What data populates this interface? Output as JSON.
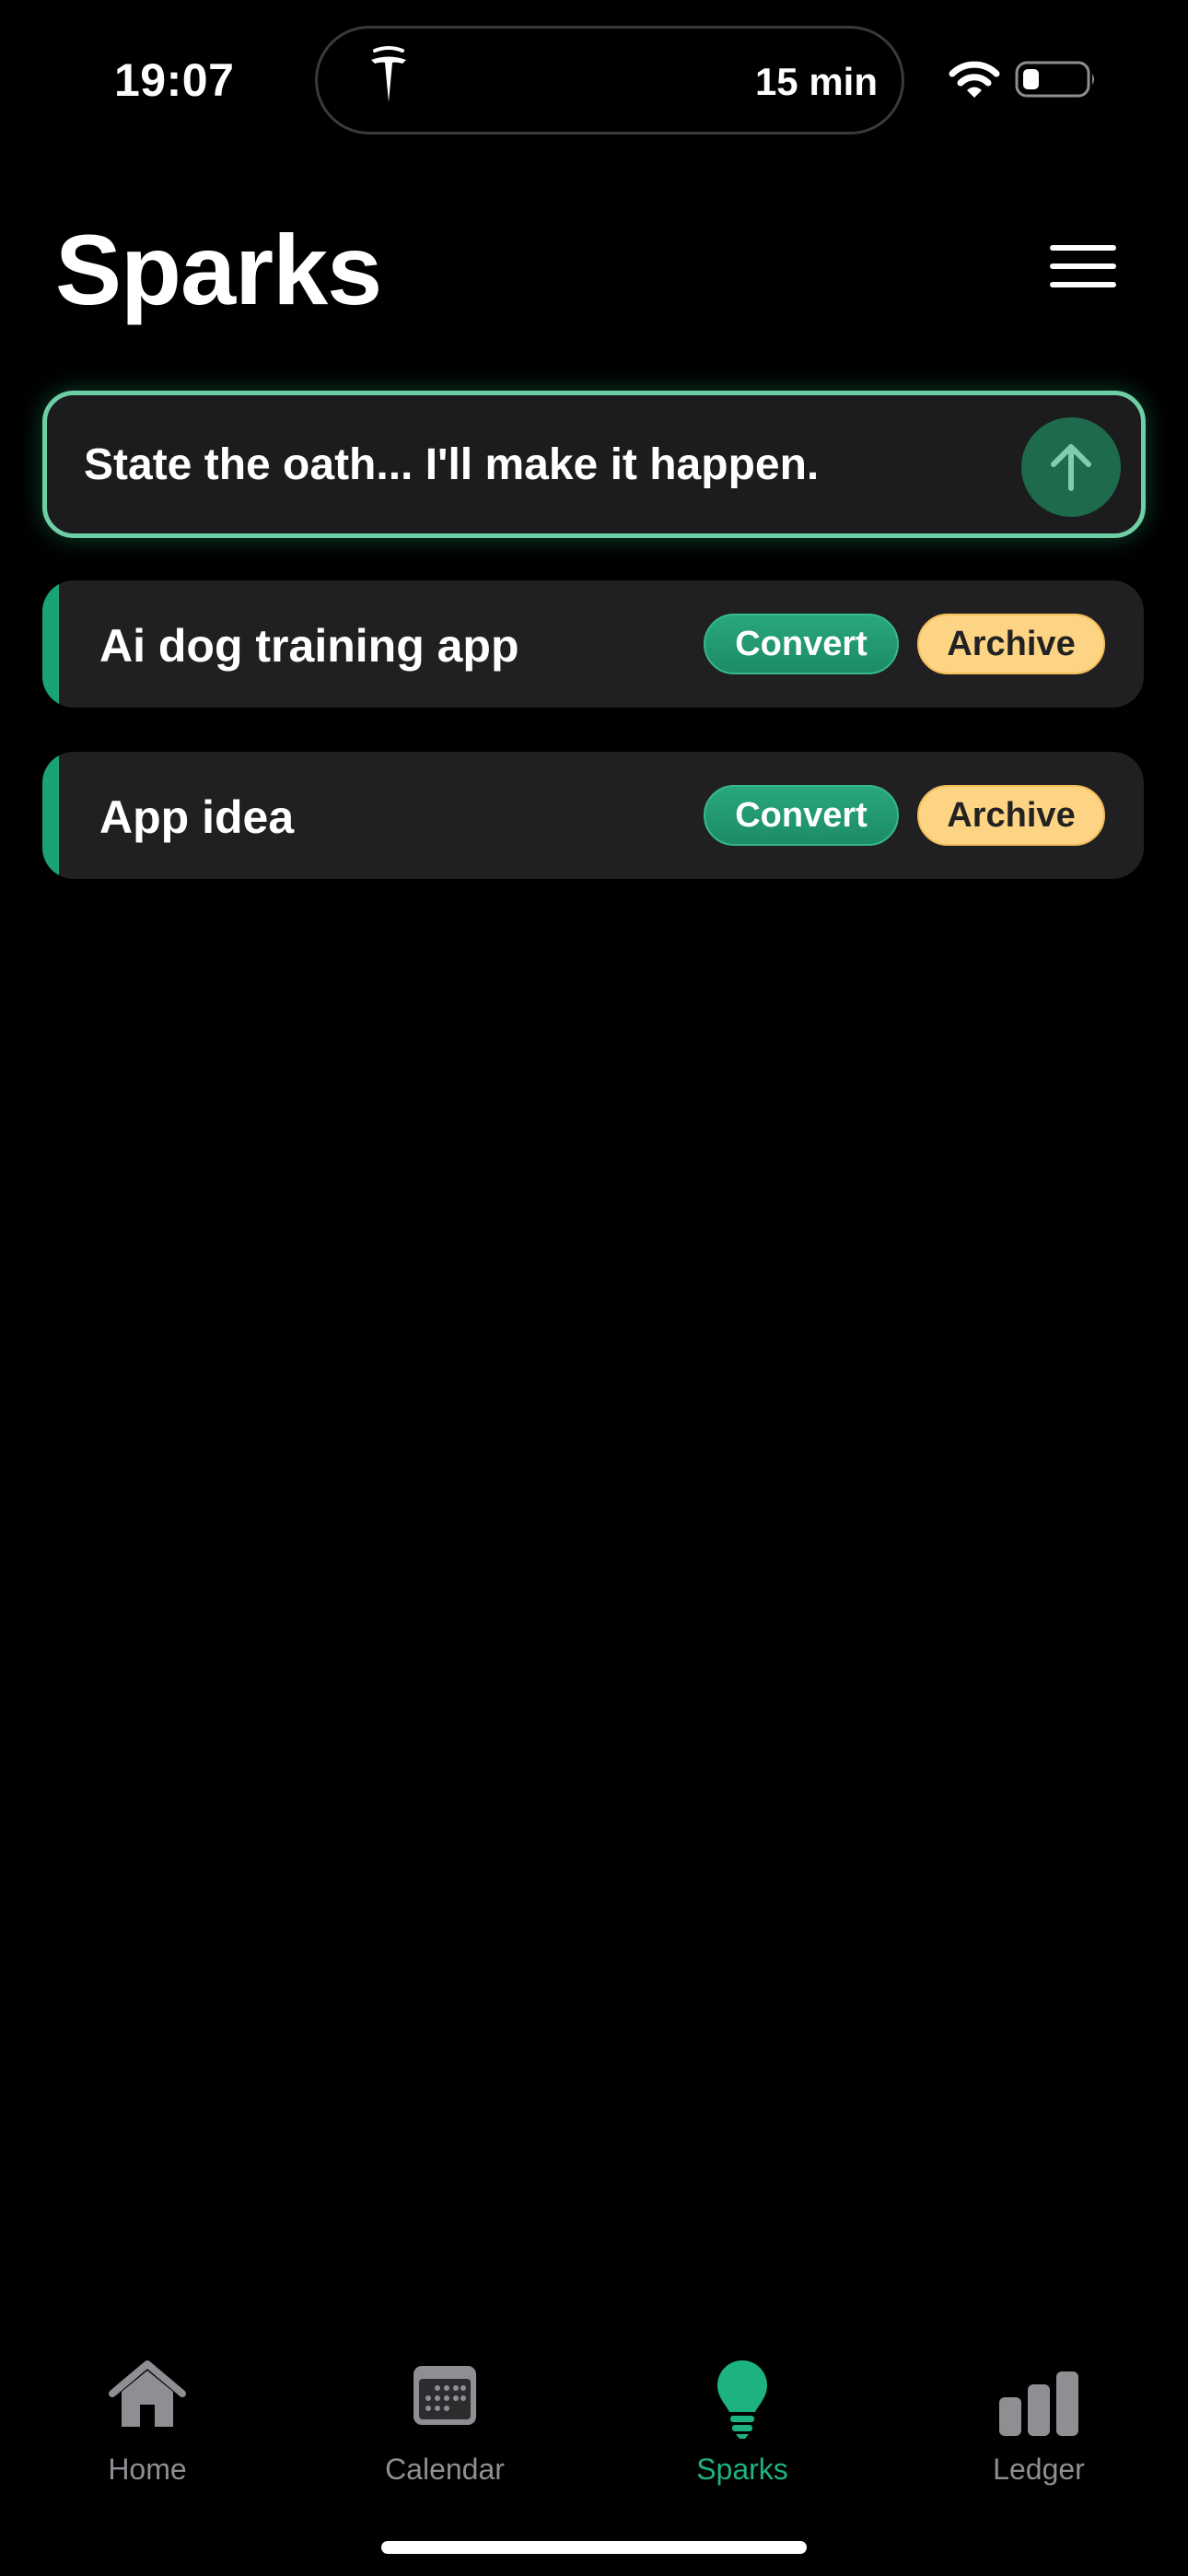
{
  "status_bar": {
    "time": "19:07",
    "island_text": "15 min",
    "island_icon": "tesla-logo-icon",
    "wifi_icon": "wifi-icon",
    "battery_icon": "battery-low-icon"
  },
  "header": {
    "title": "Sparks",
    "menu_icon": "hamburger-menu-icon"
  },
  "input": {
    "placeholder": "State the oath... I'll make it happen.",
    "submit_icon": "arrow-up-icon"
  },
  "sparks": [
    {
      "title": "Ai dog training app",
      "convert_label": "Convert",
      "archive_label": "Archive"
    },
    {
      "title": "App idea",
      "convert_label": "Convert",
      "archive_label": "Archive"
    }
  ],
  "tabs": [
    {
      "label": "Home",
      "icon": "home-icon",
      "active": false
    },
    {
      "label": "Calendar",
      "icon": "calendar-icon",
      "active": false
    },
    {
      "label": "Sparks",
      "icon": "lightbulb-icon",
      "active": true
    },
    {
      "label": "Ledger",
      "icon": "bar-chart-icon",
      "active": false
    }
  ],
  "colors": {
    "accent_green": "#1db37e",
    "archive_yellow": "#fdd384",
    "card_bg": "#202022",
    "inactive_tab": "#8e8e93"
  }
}
